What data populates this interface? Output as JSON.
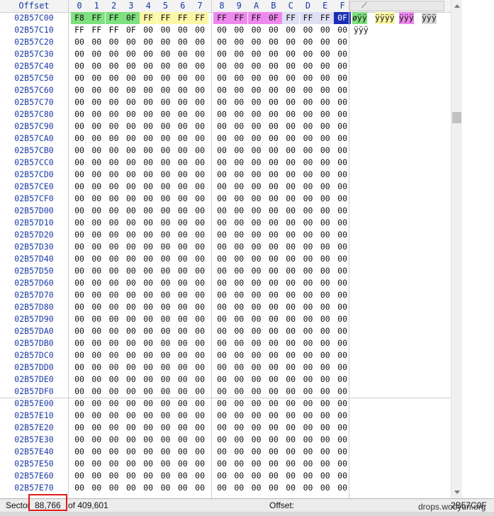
{
  "header": {
    "offset_label": "Offset",
    "columns": [
      "0",
      "1",
      "2",
      "3",
      "4",
      "5",
      "6",
      "7",
      "8",
      "9",
      "A",
      "B",
      "C",
      "D",
      "E",
      "F"
    ],
    "text_header_glyph": "⟋"
  },
  "rows": [
    {
      "offset": "02B57C00",
      "bytes": [
        "F8",
        "FF",
        "FF",
        "0F",
        "FF",
        "FF",
        "FF",
        "FF",
        "FF",
        "FF",
        "FF",
        "0F",
        "FF",
        "FF",
        "FF",
        "0F"
      ]
    },
    {
      "offset": "02B57C10",
      "bytes": [
        "FF",
        "FF",
        "FF",
        "0F",
        "00",
        "00",
        "00",
        "00",
        "00",
        "00",
        "00",
        "00",
        "00",
        "00",
        "00",
        "00"
      ]
    },
    {
      "offset": "02B57C20"
    },
    {
      "offset": "02B57C30"
    },
    {
      "offset": "02B57C40"
    },
    {
      "offset": "02B57C50"
    },
    {
      "offset": "02B57C60"
    },
    {
      "offset": "02B57C70"
    },
    {
      "offset": "02B57C80"
    },
    {
      "offset": "02B57C90"
    },
    {
      "offset": "02B57CA0"
    },
    {
      "offset": "02B57CB0"
    },
    {
      "offset": "02B57CC0"
    },
    {
      "offset": "02B57CD0"
    },
    {
      "offset": "02B57CE0"
    },
    {
      "offset": "02B57CF0"
    },
    {
      "offset": "02B57D00"
    },
    {
      "offset": "02B57D10"
    },
    {
      "offset": "02B57D20"
    },
    {
      "offset": "02B57D30"
    },
    {
      "offset": "02B57D40"
    },
    {
      "offset": "02B57D50"
    },
    {
      "offset": "02B57D60"
    },
    {
      "offset": "02B57D70"
    },
    {
      "offset": "02B57D80"
    },
    {
      "offset": "02B57D90"
    },
    {
      "offset": "02B57DA0"
    },
    {
      "offset": "02B57DB0"
    },
    {
      "offset": "02B57DC0"
    },
    {
      "offset": "02B57DD0"
    },
    {
      "offset": "02B57DE0"
    },
    {
      "offset": "02B57DF0"
    },
    {
      "offset": "02B57E00"
    },
    {
      "offset": "02B57E10"
    },
    {
      "offset": "02B57E20"
    },
    {
      "offset": "02B57E30"
    },
    {
      "offset": "02B57E40"
    },
    {
      "offset": "02B57E50"
    },
    {
      "offset": "02B57E60"
    },
    {
      "offset": "02B57E70"
    }
  ],
  "default_byte": "00",
  "text_column": {
    "row0_segments": [
      "øÿÿ",
      "ÿÿÿÿ",
      "ÿÿÿ",
      "ÿÿÿ"
    ],
    "row1": "ÿÿÿ"
  },
  "status": {
    "sector_label": "Sector",
    "sector_value": "88,766",
    "of_text": "of 409,601",
    "offset_label": "Offset:",
    "offset_value": "2B57C0F",
    "watermark": "drops.wooyun.org"
  },
  "colors": {
    "offset_text": "#1a3aa8",
    "highlight_green": "#7ee07e",
    "highlight_yellow": "#fbf7a6",
    "highlight_magenta": "#ee88ee",
    "highlight_lavender": "#e0e0f5",
    "selection": "#1b2fb5",
    "annotation_red": "#e01b1b"
  }
}
